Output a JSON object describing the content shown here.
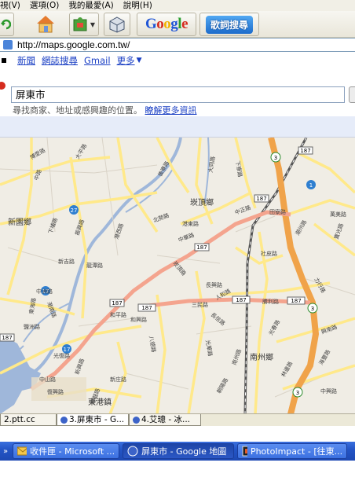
{
  "browser": {
    "menu": [
      "視(V)",
      "選項(O)",
      "我的最愛(A)",
      "說明(H)"
    ],
    "toolbar": {
      "google_logo": "Google",
      "dict_button": "歌詞搜尋"
    },
    "address": {
      "url": "http://maps.google.com.tw/"
    }
  },
  "gnav": {
    "items": [
      "新聞",
      "網誌搜尋",
      "Gmail",
      "更多"
    ],
    "more_arrow": "▼"
  },
  "search": {
    "value": "屏東市",
    "hint": "尋找商家、地址或感興趣的位置。",
    "hint_link": "瞭解更多資訊"
  },
  "map": {
    "places": [
      "崁頂鄉",
      "新園鄉",
      "南州鄉",
      "東港鎮"
    ],
    "roads": [
      "後寮路",
      "中正路",
      "田寮路",
      "港東路",
      "北勢路",
      "港西路",
      "崁頂路",
      "長興路",
      "社皮路",
      "三民路",
      "勝利路",
      "長信路",
      "和平路",
      "和興路",
      "新吉路",
      "中洲路",
      "鹽洲路",
      "光復路",
      "中山路",
      "新興路",
      "新庄路",
      "八德路",
      "人和路",
      "光華路",
      "南州路",
      "光春路",
      "朝陽路",
      "海豐路",
      "中興路",
      "港南路",
      "龍潭路",
      "振興路",
      "寶光路",
      "中華路",
      "東海路",
      "復興路",
      "潮州路",
      "港龍路",
      "力行路",
      "大同路",
      "下寮路",
      "萬美路",
      "興南路",
      "林邊路",
      "博愛路",
      "大平路",
      "中路",
      "下埔路"
    ],
    "shields": [
      "187",
      "187",
      "187",
      "187",
      "187",
      "187",
      "187",
      "187",
      "27",
      "17",
      "17",
      "1",
      "3",
      "3",
      "3"
    ]
  },
  "tabs": [
    "2.ptt.cc",
    "3.屏東市 - G...",
    "4.艾璁 - 冰..."
  ],
  "taskbar": [
    "收件匣 - Microsoft ...",
    "屏東市 - Google 地圖",
    "PhotoImpact - [往東..."
  ],
  "colors": {
    "highway": "#f0a34a",
    "route187": "#f4a48e",
    "road": "#ffe98a",
    "river": "#9fb7da",
    "link": "#1a3fc4"
  }
}
